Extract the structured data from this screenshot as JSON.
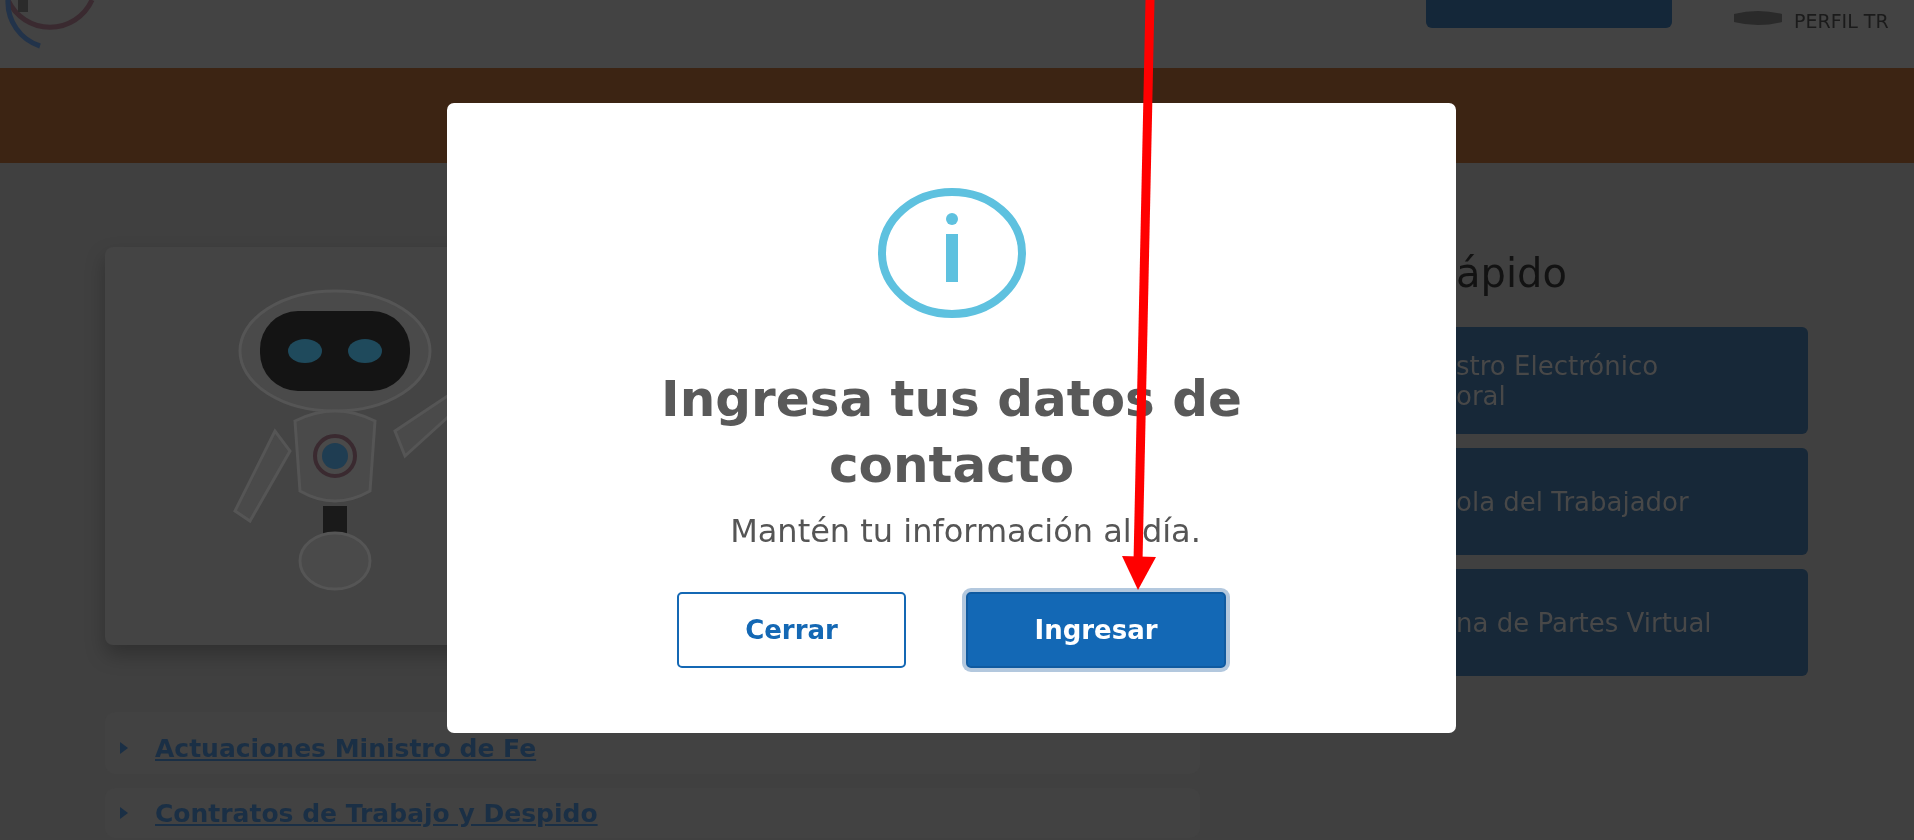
{
  "header": {
    "profile_label": "PERFIL TR"
  },
  "accordion": [
    {
      "label": "Actuaciones Ministro de Fe",
      "expanded": false
    },
    {
      "label": "Contratos de Trabajo y Despido",
      "expanded": false
    }
  ],
  "quick_access": {
    "title": "ápido",
    "links": [
      {
        "lines": [
          "stro Electrónico",
          "oral"
        ]
      },
      {
        "lines": [
          "ola del Trabajador"
        ]
      },
      {
        "lines": [
          "na de Partes Virtual"
        ]
      }
    ]
  },
  "dialog": {
    "title": "Ingresa tus datos de contacto",
    "message": "Mantén tu información al día.",
    "buttons": [
      {
        "label": "Cerrar",
        "kind": "secondary",
        "focused": false
      },
      {
        "label": "Ingresar",
        "kind": "primary",
        "focused": true
      }
    ]
  }
}
